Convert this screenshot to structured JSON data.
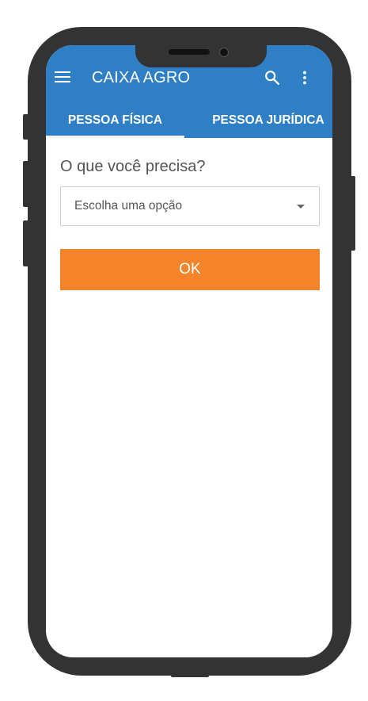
{
  "appbar": {
    "title": "CAIXA AGRO",
    "menu_icon": "menu-icon",
    "search_icon": "search-icon",
    "more_icon": "more-vert-icon",
    "color": "#2f7fc6"
  },
  "tabs": [
    {
      "label": "PESSOA FÍSICA",
      "active": true
    },
    {
      "label": "PESSOA JURÍDICA",
      "active": false
    }
  ],
  "form": {
    "question": "O que você precisa?",
    "select_placeholder": "Escolha uma opção",
    "ok_label": "OK",
    "ok_color": "#f5842b"
  }
}
